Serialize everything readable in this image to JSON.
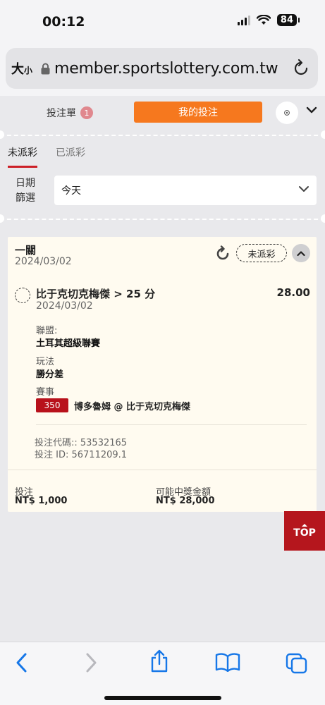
{
  "status_bar": {
    "time": "00:12",
    "battery": "84"
  },
  "address_bar": {
    "text_size_label": "大",
    "text_size_small": "小",
    "url": "member.sportslottery.com.tw"
  },
  "header": {
    "betslip_label": "投注單",
    "betslip_count": "1",
    "my_bets_label": "我的投注"
  },
  "subtabs": [
    {
      "label": "未派彩",
      "active": true
    },
    {
      "label": "已派彩",
      "active": false
    }
  ],
  "date_filter": {
    "label_line1": "日期",
    "label_line2": "篩選",
    "value": "今天"
  },
  "bet_card": {
    "type": "一關",
    "date": "2024/03/02",
    "status": "未派彩",
    "selection": "比于克切克梅傑 > 25 分",
    "odds": "28.00",
    "selection_date": "2024/03/02",
    "league_label": "聯盟:",
    "league": "土耳其超級聯賽",
    "market_label": "玩法",
    "market": "勝分差",
    "event_label": "賽事",
    "event_code": "350",
    "event_name": "博多魯姆 @ 比于克切克梅傑",
    "bet_code": "投注代碼:: 53532165",
    "bet_id": "投注 ID: 56711209.1",
    "stake_label": "投注",
    "stake": "NT$ 1,000",
    "payout_label": "可能中獎金額",
    "payout": "NT$ 28,000"
  },
  "top_button": {
    "label": "TOP"
  },
  "colors": {
    "accent_orange": "#f6781e",
    "brand_red": "#b5161d",
    "card_bg": "#fffbf0"
  }
}
